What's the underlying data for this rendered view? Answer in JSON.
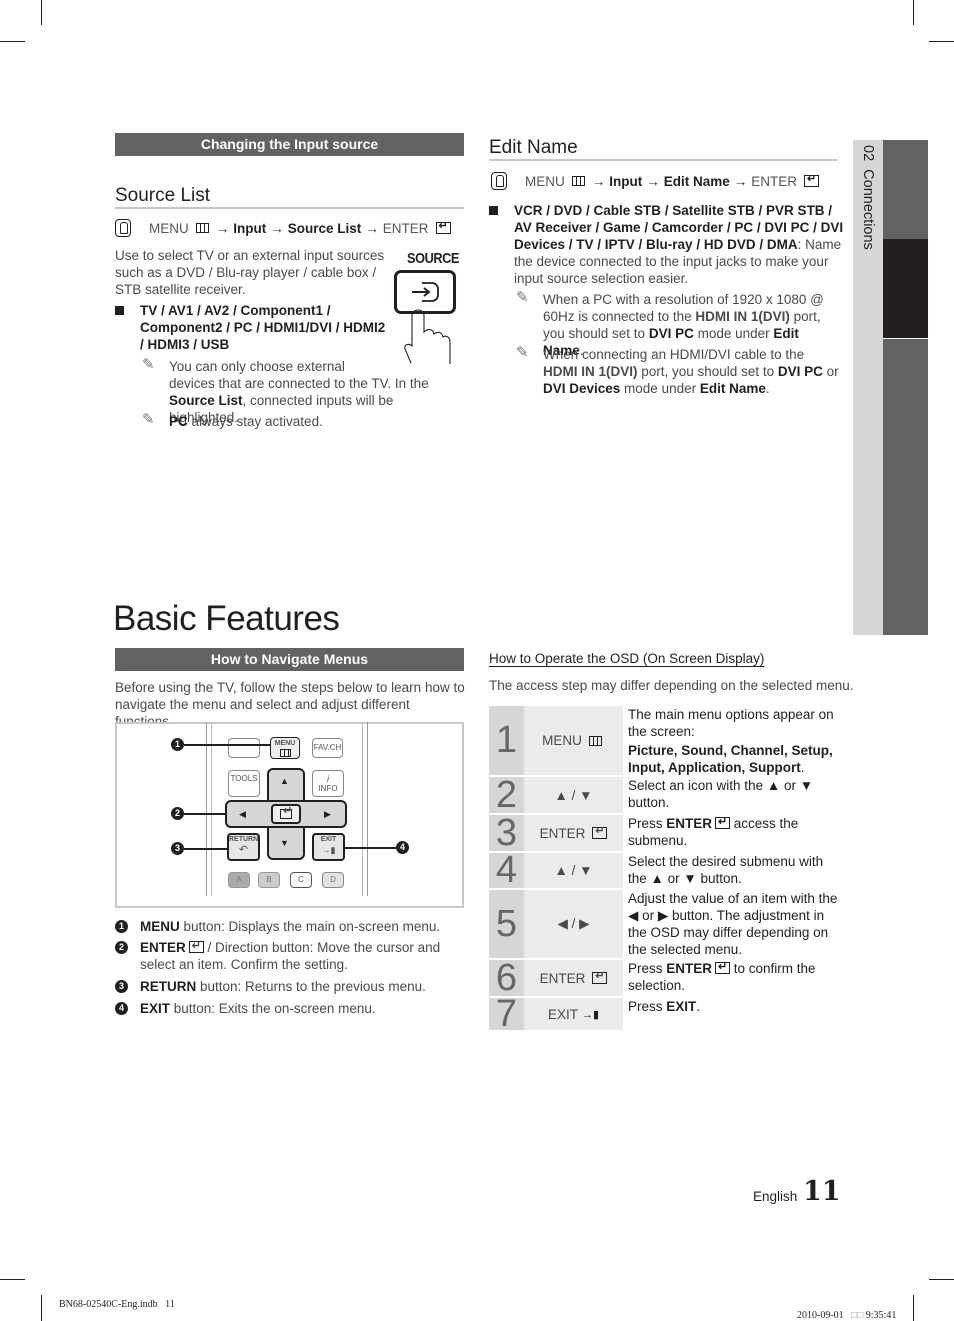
{
  "left_column": {
    "section_bar": "Changing the Input source",
    "source_list": {
      "heading": "Source List",
      "path": {
        "menu": "MENU",
        "arrow": "→",
        "input": "Input",
        "item": "Source List",
        "enter": "ENTER"
      },
      "intro_line1": "Use to select TV or an external input sources",
      "intro_line2": "such as a DVD / Blu-ray player / cable box /",
      "intro_line3": "STB satellite receiver.",
      "source_button_label": "SOURCE",
      "bullet_line1": "TV / AV1 / AV2 / Component1 /",
      "bullet_line2": "Component2 / PC / HDMI1/DVI / HDMI2",
      "bullet_line3": "/ HDMI3 / USB",
      "note1_line1": "You can only choose external",
      "note1_line2": "devices that are connected to the TV. In the",
      "note1_bold": "Source List",
      "note1_rest": ", connected inputs will be highlighted.",
      "note2_bold": "PC",
      "note2_rest": " always stay activated."
    },
    "page_title": "Basic Features",
    "navigate": {
      "section_bar": "How to Navigate Menus",
      "intro_line1": "Before using the TV, follow the steps below to learn how to",
      "intro_line2": "navigate the menu and select and adjust different functions.",
      "remote": {
        "menu": "MENU",
        "favch": "FAV.CH",
        "tools": "TOOLS",
        "info": "INFO",
        "return": "RETURN",
        "exit": "EXIT",
        "color_a": "A",
        "color_b": "B",
        "color_c": "C",
        "color_d": "D",
        "up": "▲",
        "down": "▼",
        "left": "◀",
        "right": "▶"
      },
      "legend": [
        {
          "num": "1",
          "bold": "MENU",
          "rest": " button: Displays the main on-screen menu."
        },
        {
          "num": "2",
          "bold": "ENTER",
          "rest": " / Direction button: Move the cursor and",
          "rest2": "select an item. Confirm the setting."
        },
        {
          "num": "3",
          "bold": "RETURN",
          "rest": " button: Returns to the previous menu."
        },
        {
          "num": "4",
          "bold": "EXIT",
          "rest": " button: Exits the on-screen menu."
        }
      ]
    }
  },
  "right_column": {
    "edit_name": {
      "heading": "Edit Name",
      "path": {
        "menu": "MENU",
        "arrow": "→",
        "input": "Input",
        "item": "Edit Name",
        "enter": "ENTER"
      },
      "bullet_line1": "VCR / DVD / Cable STB / Satellite STB / PVR STB /",
      "bullet_line2": "AV Receiver / Game / Camcorder / PC / DVI PC / DVI",
      "bullet_line3_bold": "Devices / TV / IPTV / Blu-ray / HD DVD / DMA",
      "bullet_line3_rest": ": Name",
      "bullet_line4": "the device connected to the input jacks to make your",
      "bullet_line5": "input source selection easier.",
      "note1_line1": "When a PC with a resolution of 1920 x 1080 @",
      "note1_line2a": "60Hz is connected to the ",
      "note1_line2b": "HDMI IN 1(DVI)",
      "note1_line2c": " port,",
      "note1_line3a": "you should set to ",
      "note1_line3b": "DVI PC",
      "note1_line3c": " mode under ",
      "note1_line3d": "Edit Name",
      "note1_line3e": ".",
      "note2_line1": "When connecting an HDMI/DVI cable to the",
      "note2_line2a": "HDMI IN 1(DVI)",
      "note2_line2b": " port, you should set to ",
      "note2_line2c": "DVI PC",
      "note2_line2d": " or",
      "note2_line3a": "DVI Devices",
      "note2_line3b": " mode under ",
      "note2_line3c": "Edit Name",
      "note2_line3d": "."
    },
    "osd": {
      "heading": "How to Operate the OSD (On Screen Display)",
      "intro": "The access step may differ depending on the selected menu.",
      "steps": [
        {
          "num": "1",
          "button": "MENU",
          "desc1": "The main menu options appear on the screen:",
          "desc_bold": "Picture, Sound, Channel, Setup, Input, Application, Support",
          "desc_end": "."
        },
        {
          "num": "2",
          "button": "▲ / ▼",
          "desc1": "Select an icon with the ▲ or ▼ button."
        },
        {
          "num": "3",
          "button": "ENTER",
          "desc_pre": "Press ",
          "desc_bold": "ENTER",
          "desc_post": " access the submenu."
        },
        {
          "num": "4",
          "button": "▲ / ▼",
          "desc1": "Select the desired submenu with the ▲ or ▼ button."
        },
        {
          "num": "5",
          "button": "◀ / ▶",
          "desc1": "Adjust the value of an item with the ◀ or ▶ button. The adjustment in the OSD may differ depending on the selected menu."
        },
        {
          "num": "6",
          "button": "ENTER",
          "desc_pre": "Press ",
          "desc_bold": "ENTER",
          "desc_post": " to confirm the selection."
        },
        {
          "num": "7",
          "button": "EXIT",
          "desc_pre": "Press ",
          "desc_bold": "EXIT",
          "desc_post": "."
        }
      ]
    }
  },
  "side_tab": {
    "label": "02  Connections"
  },
  "footer": {
    "language": "English",
    "page_number": "11",
    "file": "BN68-02540C-Eng.indb   11",
    "date": "2010-09-01",
    "glyphs": "□□",
    "time": "9:35:41"
  }
}
